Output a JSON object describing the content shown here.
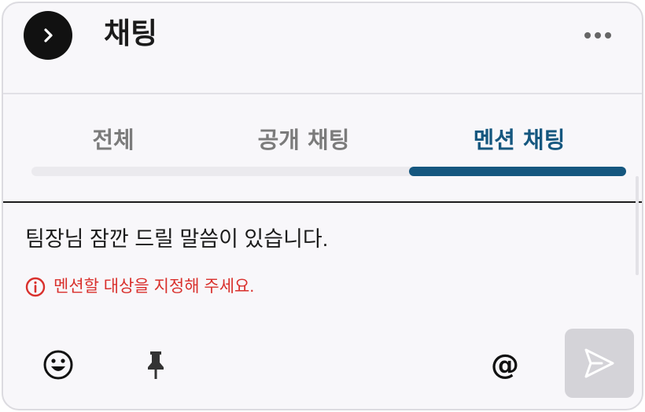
{
  "header": {
    "title": "채팅"
  },
  "tabs": [
    {
      "label": "전체",
      "active": false
    },
    {
      "label": "공개 채팅",
      "active": false
    },
    {
      "label": "멘션 채팅",
      "active": true
    }
  ],
  "composer": {
    "message": "팀장님 잠깐 드릴 말씀이 있습니다.",
    "error": "멘션할 대상을 지정해 주세요.",
    "mention_symbol": "@"
  },
  "colors": {
    "accent": "#15577f",
    "error": "#d9302c",
    "panel_bg": "#f8f7fa",
    "send_disabled": "#d4d3d8"
  },
  "icons": {
    "back": "chevron-right-icon",
    "more": "more-horizontal-icon",
    "error": "info-circle-icon",
    "emoji": "emoji-icon",
    "pin": "pin-icon",
    "send": "send-icon"
  }
}
